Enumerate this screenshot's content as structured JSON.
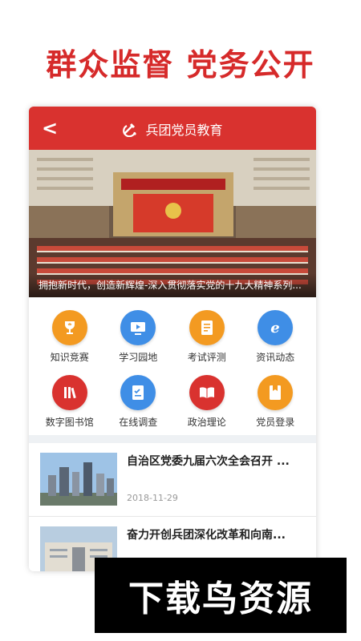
{
  "headline": "群众监督 党务公开",
  "app": {
    "title": "兵团党员教育",
    "back_icon": "back-arrow-icon"
  },
  "banner": {
    "caption": "拥抱新时代，创造新辉煌-深入贯彻落实党的十九大精神系列..."
  },
  "menu": [
    {
      "label": "知识竞赛",
      "icon": "trophy-icon",
      "color": "#f39a21"
    },
    {
      "label": "学习园地",
      "icon": "video-screen-icon",
      "color": "#3f8ee6"
    },
    {
      "label": "考试评测",
      "icon": "test-paper-icon",
      "color": "#f39a21"
    },
    {
      "label": "资讯动态",
      "icon": "e-news-icon",
      "color": "#3f8ee6"
    },
    {
      "label": "数字图书馆",
      "icon": "bookshelf-icon",
      "color": "#d9322f"
    },
    {
      "label": "在线调查",
      "icon": "checklist-icon",
      "color": "#3f8ee6"
    },
    {
      "label": "政治理论",
      "icon": "open-book-icon",
      "color": "#d9322f"
    },
    {
      "label": "党员登录",
      "icon": "bookmark-card-icon",
      "color": "#f39a21"
    }
  ],
  "news": [
    {
      "title": "自治区党委九届六次全会召开 ...",
      "date": "2018-11-29"
    },
    {
      "title": "奋力开创兵团深化改革和向南...",
      "date": ""
    }
  ],
  "watermark": "下载鸟资源",
  "colors": {
    "brand_red": "#d9322f",
    "headline_red": "#d62a2a"
  }
}
